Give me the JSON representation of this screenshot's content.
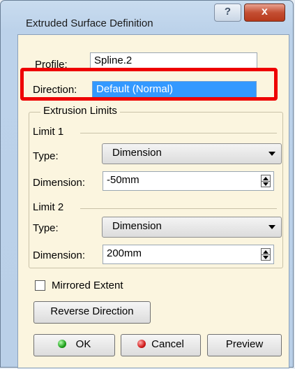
{
  "window": {
    "title": "Extruded Surface Definition",
    "help_label": "?",
    "close_label": "x"
  },
  "profile": {
    "label": "Profile:",
    "value": "Spline.2"
  },
  "direction": {
    "label": "Direction:",
    "value": "Default (Normal)"
  },
  "extrusion_limits": {
    "title": "Extrusion Limits",
    "limit1": {
      "title": "Limit 1",
      "type_label": "Type:",
      "type_value": "Dimension",
      "dimension_label": "Dimension:",
      "dimension_value": "-50mm"
    },
    "limit2": {
      "title": "Limit 2",
      "type_label": "Type:",
      "type_value": "Dimension",
      "dimension_label": "Dimension:",
      "dimension_value": "200mm"
    }
  },
  "mirrored": {
    "label": "Mirrored Extent",
    "checked": false
  },
  "buttons": {
    "reverse": "Reverse Direction",
    "ok": "OK",
    "cancel": "Cancel",
    "preview": "Preview"
  },
  "colors": {
    "highlight": "#ee0000",
    "selection": "#3399ff",
    "panel": "#fbf5df"
  }
}
